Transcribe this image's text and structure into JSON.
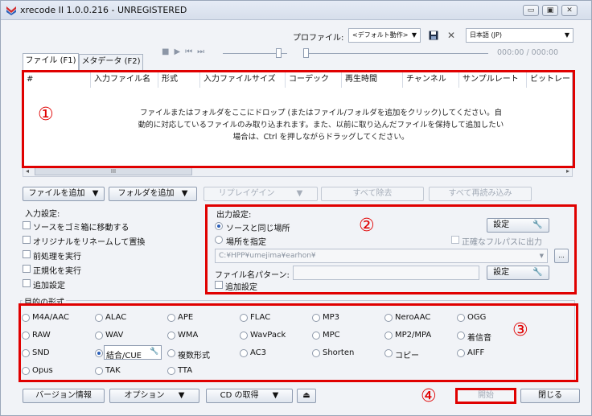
{
  "window": {
    "title": "xrecode II 1.0.0.216 - UNREGISTERED",
    "min_glyph": "▭",
    "max_glyph": "▣",
    "close_glyph": "✕"
  },
  "toolbar": {
    "profile_label": "プロファイル:",
    "profile_value": "<デフォルト動作>",
    "language_value": "日本語 (JP)",
    "time_display": "000:00 / 000:00",
    "save_icon": "floppy-icon",
    "close_glyph": "✕"
  },
  "tabs": [
    {
      "label": "ファイル (F1)"
    },
    {
      "label": "メタデータ (F2)"
    }
  ],
  "file_list": {
    "columns": [
      "#",
      "入力ファイル名",
      "形式",
      "入力ファイルサイズ",
      "コーデック",
      "再生時間",
      "チャンネル",
      "サンプルレート",
      "ビットレー"
    ],
    "drop_message_1": "ファイルまたはフォルダをここにドロップ (またはファイル/フォルダを追加をクリック)してください。自",
    "drop_message_2": "動的に対応しているファイルのみ取り込まれます。また、以前に取り込んだファイルを保持して追加したい",
    "drop_message_3": "場合は、Ctrl を押しながらドラッグしてください。",
    "scroll_thumb": "III"
  },
  "actions": {
    "add_file": "ファイルを追加",
    "add_folder": "フォルダを追加",
    "replaygain": "リプレイゲイン",
    "remove_all": "すべて除去",
    "reload_all": "すべて再読み込み"
  },
  "input_settings": {
    "title": "入力設定:",
    "options": [
      "ソースをゴミ箱に移動する",
      "オリジナルをリネームして置換",
      "前処理を実行",
      "正規化を実行",
      "追加設定"
    ]
  },
  "output_settings": {
    "title": "出力設定:",
    "same_as_source": "ソースと同じ場所",
    "specify_location": "場所を指定",
    "settings_button": "設定",
    "full_path_checkbox": "正確なフルパスに出力",
    "path_value": "C:¥HPP¥umejima¥earhon¥",
    "browse_glyph": "...",
    "filename_pattern_label": "ファイル名パターン:",
    "pattern_settings_button": "設定",
    "extra_settings": "追加設定"
  },
  "target_format": {
    "title": "目的の形式",
    "formats": [
      [
        "M4A/AAC",
        "ALAC",
        "APE",
        "FLAC",
        "MP3",
        "NeroAAC",
        "OGG"
      ],
      [
        "RAW",
        "WAV",
        "WMA",
        "WavPack",
        "MPC",
        "MP2/MPA",
        "着信音"
      ],
      [
        "SND",
        "結合/CUE",
        "複数形式",
        "AC3",
        "Shorten",
        "コピー",
        "AIFF"
      ],
      [
        "Opus",
        "TAK",
        "TTA"
      ]
    ],
    "selected": "結合/CUE"
  },
  "bottom": {
    "version_info": "バージョン情報",
    "options": "オプション",
    "cd_fetch": "CD の取得",
    "start": "開始",
    "close": "閉じる"
  },
  "annotations": {
    "n1": "①",
    "n2": "②",
    "n3": "③",
    "n4": "④"
  },
  "colors": {
    "annotation_red": "#e00000",
    "accent_blue": "#2b5fb8"
  }
}
